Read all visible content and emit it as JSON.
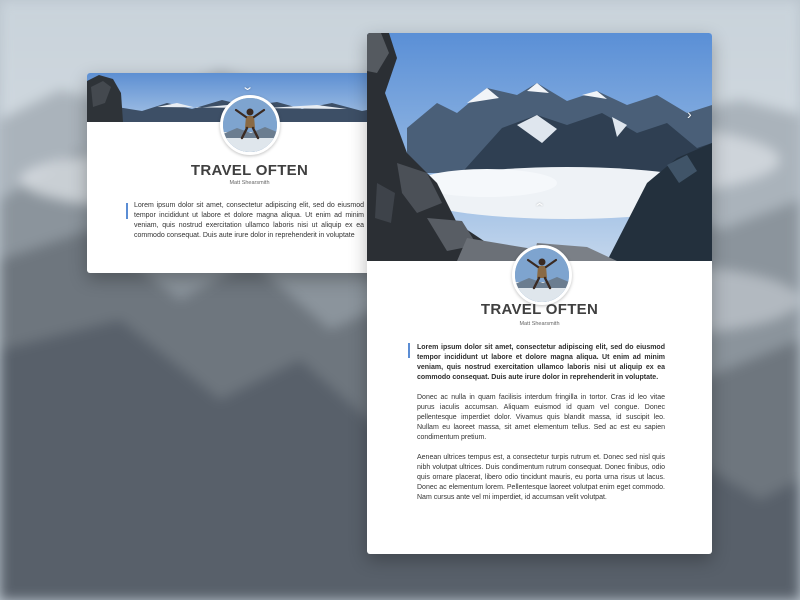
{
  "small_card": {
    "title": "TRAVEL OFTEN",
    "author": "Matt Shearsmith",
    "paragraph": "Lorem ipsum dolor sit amet, consectetur adipiscing elit, sed do eiusmod tempor incididunt ut labore et dolore magna aliqua. Ut enim ad minim veniam, quis nostrud exercitation ullamco laboris nisi ut aliquip ex ea commodo consequat. Duis aute irure dolor in reprehenderit in voluptate"
  },
  "large_card": {
    "title": "TRAVEL OFTEN",
    "author": "Matt Shearsmith",
    "paragraphs": [
      "Lorem ipsum dolor sit amet, consectetur adipiscing elit, sed do eiusmod tempor incididunt ut labore et dolore magna aliqua. Ut enim ad minim veniam, quis nostrud exercitation ullamco laboris nisi ut aliquip ex ea commodo consequat. Duis aute irure dolor in reprehenderit in voluptate.",
      "Donec ac nulla in quam facilisis interdum fringilla in tortor. Cras id leo vitae purus iaculis accumsan. Aliquam euismod id quam vel congue. Donec pellentesque imperdiet dolor. Vivamus quis blandit massa, id suscipit leo. Nullam eu laoreet massa, sit amet elementum tellus. Sed ac est eu sapien condimentum pretium.",
      "Aenean ultrices tempus est, a consectetur turpis rutrum et. Donec sed nisl quis nibh volutpat ultrices. Duis condimentum rutrum consequat. Donec finibus, odio quis ornare placerat, libero odio tincidunt mauris, eu porta urna risus ut lacus. Donec ac elementum lorem. Pellentesque laoreet volutpat enim eget commodo. Nam cursus ante vel mi imperdiet, id accumsan velit volutpat."
    ]
  },
  "icons": {
    "collapse": "chevron-down-icon",
    "expand": "chevron-up-icon",
    "next": "chevron-right-icon"
  },
  "colors": {
    "accent": "#5b8dd4",
    "title": "#3f3f3f",
    "sky": "#6f9bd3"
  }
}
